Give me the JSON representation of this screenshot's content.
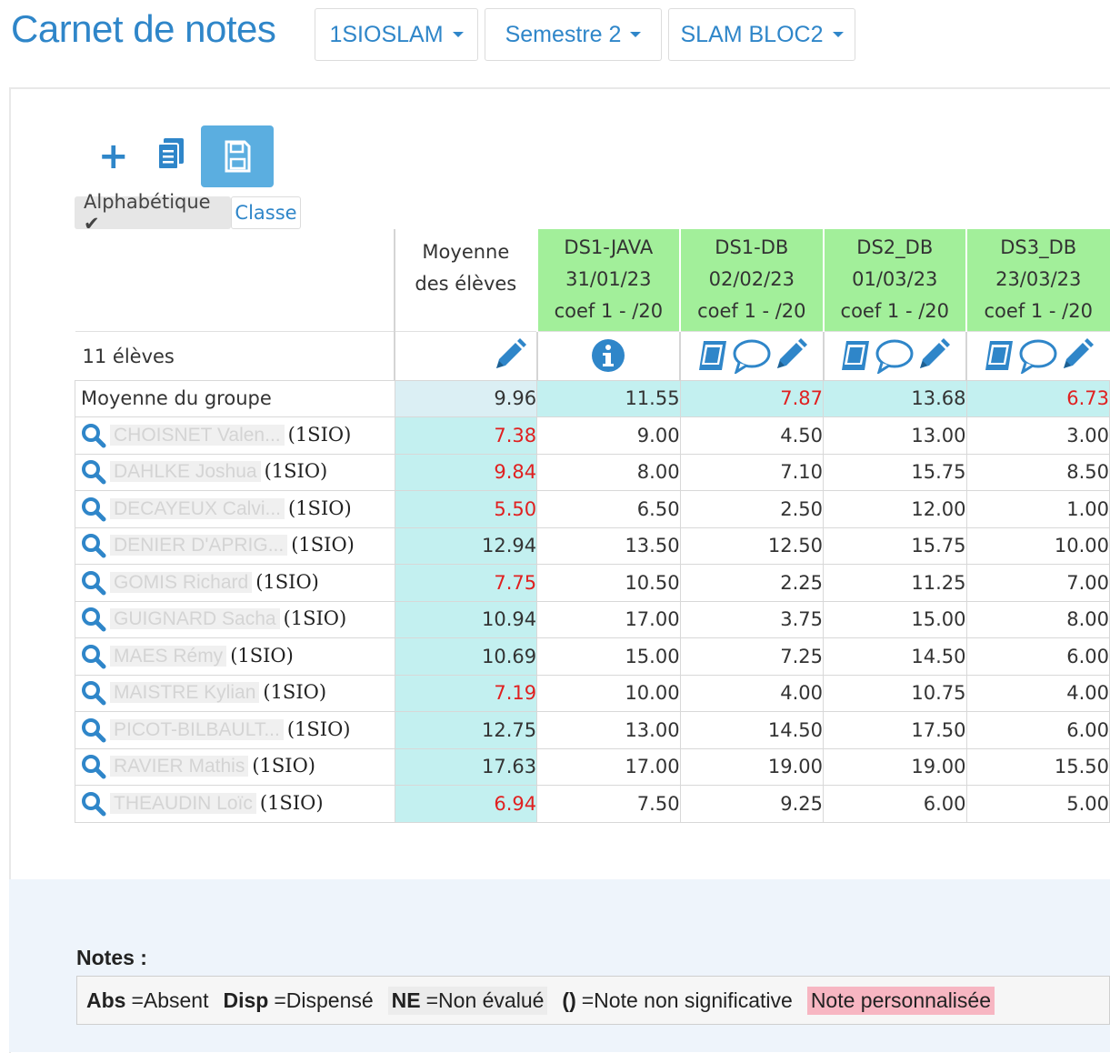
{
  "header": {
    "title": "Carnet de notes",
    "dropdowns": [
      "1SIOSLAM",
      "Semestre 2",
      "SLAM BLOC2"
    ]
  },
  "sort": {
    "alpha_label": "Alphabétique ✔",
    "classe_label": "Classe"
  },
  "grid": {
    "moyenne_header": [
      "Moyenne",
      "des élèves"
    ],
    "count_label": "11 élèves",
    "evaluations": [
      {
        "name": "DS1-JAVA",
        "date": "31/01/23",
        "coef": "coef 1 - /20"
      },
      {
        "name": "DS1-DB",
        "date": "02/02/23",
        "coef": "coef 1 - /20"
      },
      {
        "name": "DS2_DB",
        "date": "01/03/23",
        "coef": "coef 1 - /20"
      },
      {
        "name": "DS3_DB",
        "date": "23/03/23",
        "coef": "coef 1 - /20"
      }
    ],
    "group_label": "Moyenne du groupe",
    "group_avg": "9.96",
    "group_scores": [
      "11.55",
      "7.87",
      "13.68",
      "6.73"
    ],
    "students": [
      {
        "name": "CHOISNET Valen...",
        "cls": "(1SIO)",
        "avg": "7.38",
        "scores": [
          "9.00",
          "4.50",
          "13.00",
          "3.00"
        ]
      },
      {
        "name": "DAHLKE Joshua",
        "cls": "(1SIO)",
        "avg": "9.84",
        "scores": [
          "8.00",
          "7.10",
          "15.75",
          "8.50"
        ]
      },
      {
        "name": "DECAYEUX Calvi...",
        "cls": "(1SIO)",
        "avg": "5.50",
        "scores": [
          "6.50",
          "2.50",
          "12.00",
          "1.00"
        ]
      },
      {
        "name": "DENIER D'APRIG...",
        "cls": "(1SIO)",
        "avg": "12.94",
        "scores": [
          "13.50",
          "12.50",
          "15.75",
          "10.00"
        ]
      },
      {
        "name": "GOMIS Richard",
        "cls": "(1SIO)",
        "avg": "7.75",
        "scores": [
          "10.50",
          "2.25",
          "11.25",
          "7.00"
        ]
      },
      {
        "name": "GUIGNARD Sacha",
        "cls": "(1SIO)",
        "avg": "10.94",
        "scores": [
          "17.00",
          "3.75",
          "15.00",
          "8.00"
        ]
      },
      {
        "name": "MAES Rémy",
        "cls": "(1SIO)",
        "avg": "10.69",
        "scores": [
          "15.00",
          "7.25",
          "14.50",
          "6.00"
        ]
      },
      {
        "name": "MAISTRE Kylian",
        "cls": "(1SIO)",
        "avg": "7.19",
        "scores": [
          "10.00",
          "4.00",
          "10.75",
          "4.00"
        ]
      },
      {
        "name": "PICOT-BILBAULT...",
        "cls": "(1SIO)",
        "avg": "12.75",
        "scores": [
          "13.00",
          "14.50",
          "17.50",
          "6.00"
        ]
      },
      {
        "name": "RAVIER Mathis",
        "cls": "(1SIO)",
        "avg": "17.63",
        "scores": [
          "17.00",
          "19.00",
          "19.00",
          "15.50"
        ]
      },
      {
        "name": "THEAUDIN Loïc",
        "cls": "(1SIO)",
        "avg": "6.94",
        "scores": [
          "7.50",
          "9.25",
          "6.00",
          "5.00"
        ]
      }
    ]
  },
  "notes": {
    "label": "Notes :",
    "legend": [
      {
        "key": "Abs",
        "text": "=Absent"
      },
      {
        "key": "Disp",
        "text": "=Dispensé"
      },
      {
        "key": "NE",
        "text": "=Non évalué"
      },
      {
        "key": "()",
        "text": "=Note non significative"
      }
    ],
    "perso": "Note personnalisée"
  },
  "colors": {
    "accent": "#2f86c9",
    "eval_header": "#a2ef9a",
    "avg_col": "#c3f0f0",
    "low": "#e02020",
    "perso": "#f7b6c2"
  },
  "icons": {
    "toolbar": [
      "plus-icon",
      "copy-icon",
      "save-icon"
    ],
    "row": "magnifier-icon",
    "moyenne": "pencil-icon",
    "ds1_java": "info-icon",
    "others": [
      "book-icon",
      "comment-icon",
      "pencil-icon"
    ]
  }
}
